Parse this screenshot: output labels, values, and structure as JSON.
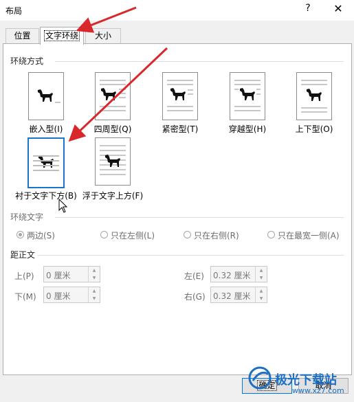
{
  "dialog": {
    "title": "布局",
    "help_icon": "?",
    "close_icon": "✕"
  },
  "tabs": [
    "位置",
    "文字环绕",
    "大小"
  ],
  "active_tab": "文字环绕",
  "wrap_style": {
    "label": "环绕方式",
    "options": [
      "嵌入型(I)",
      "四周型(Q)",
      "紧密型(T)",
      "穿越型(H)",
      "上下型(O)",
      "衬于文字下方(B)",
      "浮于文字上方(F)"
    ],
    "selected": "衬于文字下方(B)"
  },
  "wrap_text": {
    "label": "环绕文字",
    "options": [
      "两边(S)",
      "只在左侧(L)",
      "只在右侧(R)",
      "只在最宽一侧(A)"
    ],
    "selected": "两边(S)"
  },
  "distance": {
    "label": "距正文",
    "top": {
      "label": "上(P)",
      "value": "0 厘米"
    },
    "bottom": {
      "label": "下(M)",
      "value": "0 厘米"
    },
    "left": {
      "label": "左(E)",
      "value": "0.32 厘米"
    },
    "right": {
      "label": "右(G)",
      "value": "0.32 厘米"
    }
  },
  "buttons": {
    "ok": "确定",
    "cancel": "取消"
  },
  "watermark": {
    "text": "极光下载站",
    "url": "www.xz7.com"
  },
  "colors": {
    "accent": "#1b74c9",
    "annotation_arrow": "#d9282c"
  }
}
